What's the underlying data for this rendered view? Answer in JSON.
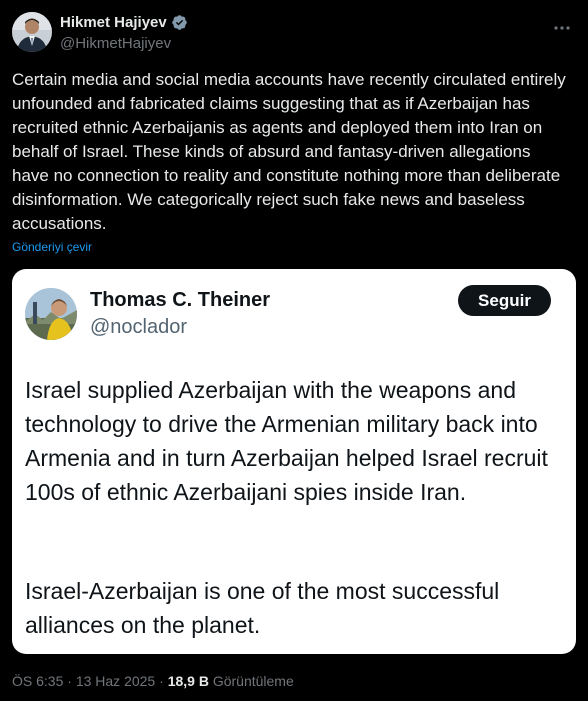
{
  "author": {
    "display_name": "Hikmet Hajiyev",
    "handle": "@HikmetHajiyev",
    "verified": true
  },
  "tweet": {
    "text": "Certain media and social media accounts have recently circulated entirely unfounded and fabricated claims suggesting that as if Azerbaijan has recruited ethnic Azerbaijanis as agents and deployed them into Iran on behalf of Israel. These kinds of absurd and fantasy-driven allegations have no connection to reality and constitute nothing more than deliberate disinformation. We categorically reject such fake news and baseless accusations.",
    "translate_label": "Gönderiyi çevir"
  },
  "quoted": {
    "display_name": "Thomas C. Theiner",
    "handle": "@noclador",
    "follow_label": "Seguir",
    "paragraph_1": "Israel supplied Azerbaijan with the weapons and technology to drive the Armenian military back into Armenia and in turn Azerbaijan helped Israel recruit 100s of ethnic Azerbaijani spies inside Iran.",
    "paragraph_2": "Israel-Azerbaijan is one of the most successful alliances on the planet."
  },
  "meta": {
    "time": "ÖS 6:35",
    "separator": "·",
    "date": "13 Haz 2025",
    "views_count": "18,9 B",
    "views_label": "Görüntüleme"
  },
  "colors": {
    "background": "#000000",
    "text_primary": "#e7e9ea",
    "text_secondary": "#71767b",
    "link": "#1d9bf0",
    "verified_badge": "#829aab",
    "quote_background": "#ffffff"
  },
  "icons": {
    "verified": "verified-badge-icon",
    "more": "more-horizontal-icon"
  }
}
